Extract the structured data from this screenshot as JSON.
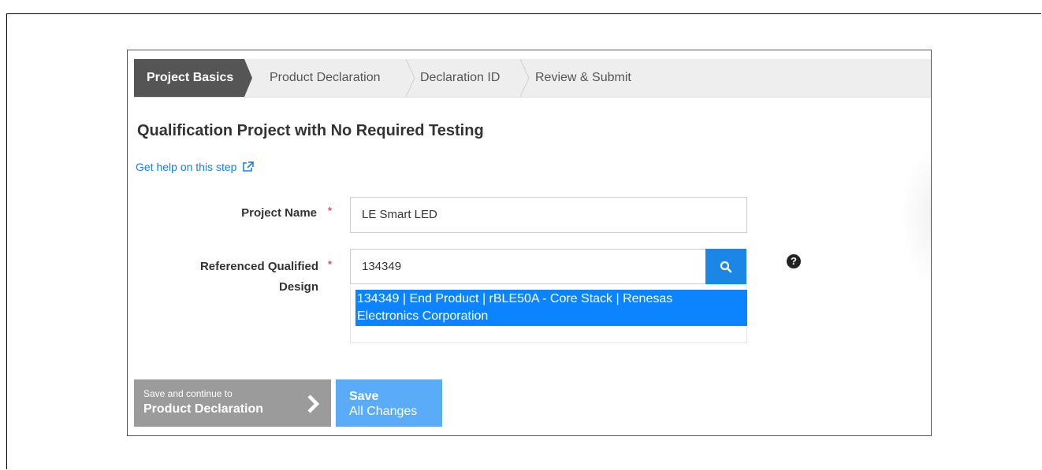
{
  "steps": [
    {
      "label": "Project Basics",
      "active": true
    },
    {
      "label": "Product Declaration",
      "active": false
    },
    {
      "label": "Declaration ID",
      "active": false
    },
    {
      "label": "Review & Submit",
      "active": false
    }
  ],
  "page": {
    "title": "Qualification Project with No Required Testing",
    "help_link": "Get help on this step"
  },
  "form": {
    "project_name": {
      "label": "Project Name",
      "required_mark": "*",
      "value": "LE Smart LED"
    },
    "referenced_design": {
      "label_line1": "Referenced Qualified",
      "label_line2": "Design",
      "required_mark": "*",
      "value": "134349",
      "help_icon_text": "?",
      "suggestion_line1": "134349 | End Product | rBLE50A - Core Stack | Renesas",
      "suggestion_line2": "Electronics Corporation"
    }
  },
  "buttons": {
    "continue_small": "Save and continue to",
    "continue_big": "Product Declaration",
    "save_line1": "Save",
    "save_line2": "All Changes"
  },
  "colors": {
    "active_step": "#555555",
    "link": "#1a7ee6",
    "search_button": "#1c86e6",
    "dropdown_highlight": "#0c84ff",
    "continue_button": "#9b9b9b",
    "save_button": "#5aacf8",
    "required": "#d9534f"
  },
  "icons": {
    "external_link": "external-link-icon",
    "search": "search-icon",
    "help": "question-circle-icon",
    "next": "chevron-right-icon"
  }
}
